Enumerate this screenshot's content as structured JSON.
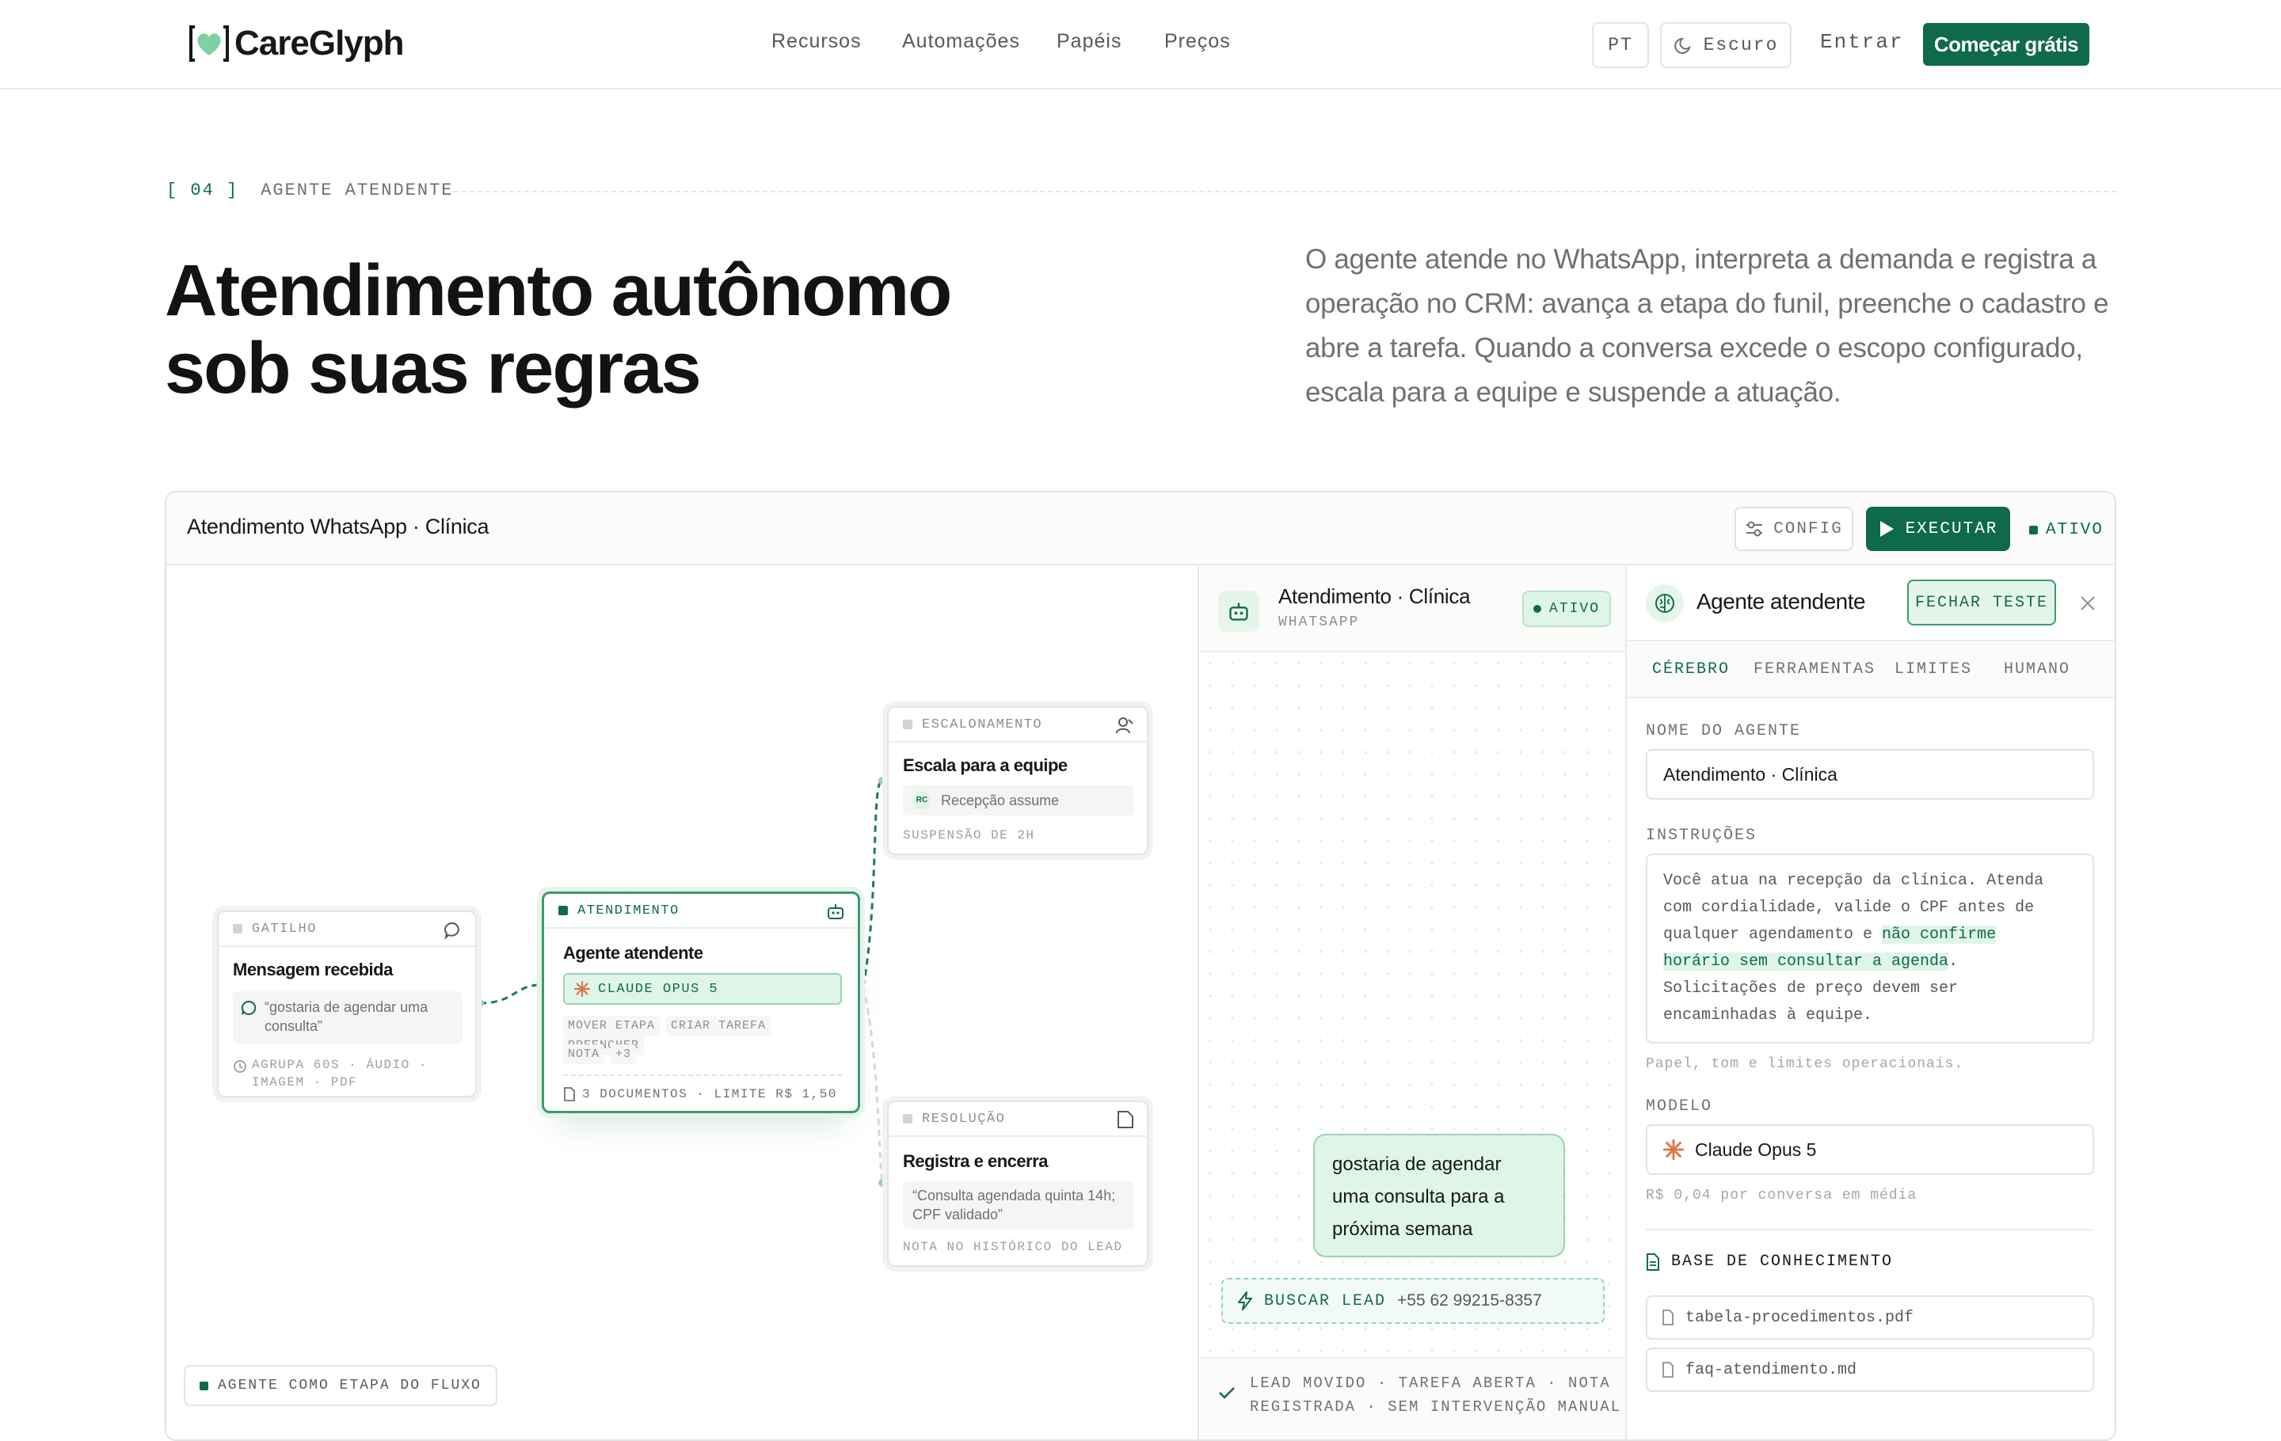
{
  "nav": {
    "brand": "CareGlyph",
    "links": [
      "Recursos",
      "Automações",
      "Papéis",
      "Preços"
    ],
    "lang": "PT",
    "theme": "Escuro",
    "login": "Entrar",
    "cta": "Começar grátis"
  },
  "section": {
    "number": "[ 04 ]",
    "label": "AGENTE ATENDENTE",
    "title_line1": "Atendimento autônomo",
    "title_line2": "sob suas regras",
    "description": "O agente atende no WhatsApp, interpreta a demanda e registra a operação no CRM: avança a etapa do funil, preenche o cadastro e abre a tarefa. Quando a conversa excede o escopo configurado, escala para a equipe e suspende a atuação."
  },
  "window": {
    "title": "Atendimento WhatsApp · Clínica",
    "config_label": "CONFIG",
    "execute_label": "EXECUTAR",
    "status": "ATIVO"
  },
  "flow": {
    "trigger": {
      "tag": "GATILHO",
      "title": "Mensagem recebida",
      "quote": "“gostaria de agendar uma consulta”",
      "meta_line1": "AGRUPA 60S · ÁUDIO ·",
      "meta_line2": "IMAGEM · PDF"
    },
    "agent": {
      "tag": "ATENDIMENTO",
      "title": "Agente atendente",
      "model": "CLAUDE OPUS 5",
      "tools_line1": [
        "MOVER ETAPA",
        "CRIAR TAREFA",
        "PREENCHER"
      ],
      "tools_line2": [
        "NOTA",
        "+3"
      ],
      "footer": "3 DOCUMENTOS · LIMITE R$ 1,50"
    },
    "escalation": {
      "tag": "ESCALONAMENTO",
      "title": "Escala para a equipe",
      "assignee_initials": "RC",
      "assignee": "Recepção assume",
      "meta": "SUSPENSÃO DE 2H"
    },
    "resolution": {
      "tag": "RESOLUÇÃO",
      "title": "Registra e encerra",
      "quote_line1": "“Consulta agendada quinta 14h;",
      "quote_line2": "CPF validado”",
      "meta": "NOTA NO HISTÓRICO DO LEAD"
    },
    "badge": "AGENTE COMO ETAPA DO FLUXO"
  },
  "chat": {
    "title": "Atendimento · Clínica",
    "channel": "WHATSAPP",
    "status": "ATIVO",
    "message_line1": "gostaria de agendar",
    "message_line2": "uma consulta para a",
    "message_line3": "próxima semana",
    "tool_call": "BUSCAR LEAD",
    "tool_value": "+55 62 99215-8357",
    "footer_line1": "LEAD MOVIDO · TAREFA ABERTA · NOTA",
    "footer_line2": "REGISTRADA · SEM INTERVENÇÃO MANUAL"
  },
  "panel": {
    "title": "Agente atendente",
    "close_test": "FECHAR TESTE",
    "tabs": [
      "CÉREBRO",
      "FERRAMENTAS",
      "LIMITES",
      "HUMANO"
    ],
    "active_tab": "CÉREBRO",
    "name_label": "NOME DO AGENTE",
    "name_value": "Atendimento · Clínica",
    "instructions_label": "INSTRUÇÕES",
    "instr_1": "Você atua na recepção da clínica. Atenda",
    "instr_2": "com cordialidade, valide o CPF antes de",
    "instr_3a": "qualquer agendamento e ",
    "instr_3b": "não confirme",
    "instr_4a": "horário sem consultar a agenda",
    "instr_4b": ".",
    "instr_5": "Solicitações de preço devem ser",
    "instr_6": "encaminhadas à equipe.",
    "instructions_help": "Papel, tom e limites operacionais.",
    "model_label": "MODELO",
    "model_value": "Claude Opus 5",
    "model_help": "R$ 0,04 por conversa em média",
    "kb_label": "BASE DE CONHECIMENTO",
    "kb_files": [
      "tabela-procedimentos.pdf",
      "faq-atendimento.md"
    ]
  },
  "colors": {
    "brand_green": "#0f6a4a",
    "mint": "#dff5e8",
    "claude_orange": "#d9774b"
  }
}
